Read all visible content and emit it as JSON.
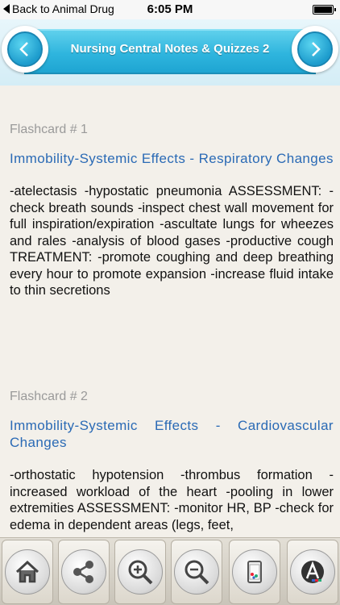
{
  "status_bar": {
    "back_label": "Back to Animal Drug",
    "time": "6:05 PM"
  },
  "header": {
    "title": "Nursing Central Notes & Quizzes 2",
    "prev_icon": "chevron-left-icon",
    "next_icon": "chevron-right-icon"
  },
  "cards": [
    {
      "number": "Flashcard # 1",
      "title": "Immobility-Systemic Effects - Respiratory Changes",
      "body": "-atelectasis -hypostatic pneumonia ASSESSMENT: -check breath sounds -inspect chest wall movement for full inspiration/expiration -ascultate lungs for wheezes and rales -analysis of blood gases -productive cough TREATMENT: -promote coughing and deep breathing every hour to promote expansion -increase fluid intake to thin secretions"
    },
    {
      "number": "Flashcard # 2",
      "title": "Immobility-Systemic Effects - Cardiovascular Changes",
      "body": "-orthostatic hypotension -thrombus formation -increased workload of the heart -pooling in lower extremities ASSESSMENT: -monitor HR, BP -check for edema in dependent areas (legs, feet,"
    }
  ],
  "toolbar": {
    "buttons": [
      {
        "icon": "home-icon"
      },
      {
        "icon": "share-icon"
      },
      {
        "icon": "zoom-in-icon"
      },
      {
        "icon": "zoom-out-icon"
      },
      {
        "icon": "tablet-icon"
      },
      {
        "icon": "font-color-icon"
      }
    ]
  },
  "colors": {
    "banner": "#2fb5de",
    "title_text": "#2a6ab5",
    "card_number": "#9a9a9a",
    "background": "#f3f0ea"
  }
}
